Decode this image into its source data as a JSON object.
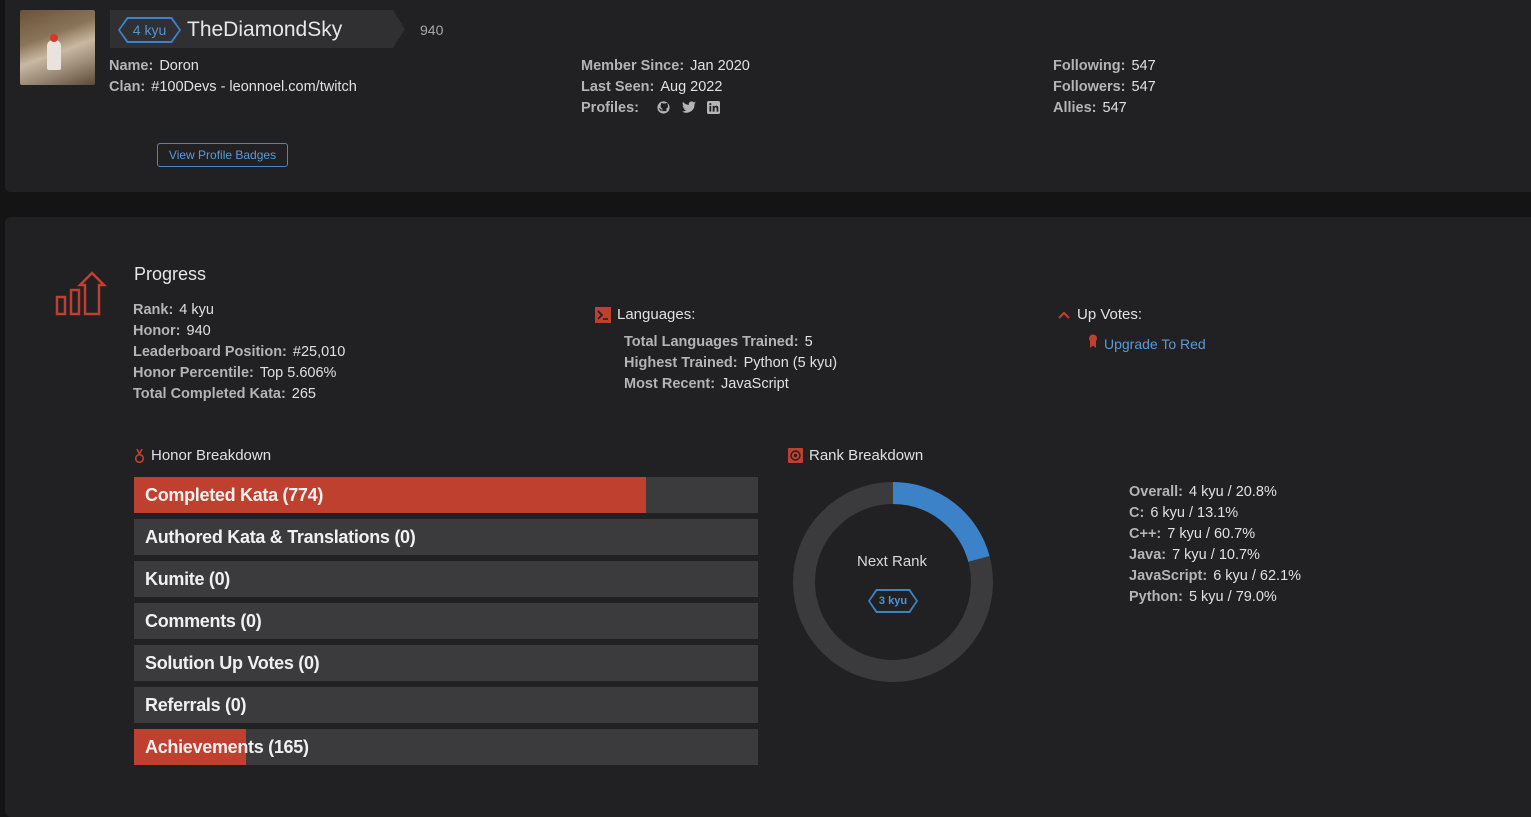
{
  "profile": {
    "kyu_badge": "4 kyu",
    "username": "TheDiamondSky",
    "honor": "940",
    "name_label": "Name:",
    "name_value": "Doron",
    "clan_label": "Clan:",
    "clan_value": "#100Devs - leonnoel.com/twitch",
    "member_since_label": "Member Since:",
    "member_since_value": "Jan 2020",
    "last_seen_label": "Last Seen:",
    "last_seen_value": "Aug 2022",
    "profiles_label": "Profiles:",
    "profile_icons": [
      "github-icon",
      "twitter-icon",
      "linkedin-icon"
    ],
    "following_label": "Following:",
    "following_value": "547",
    "followers_label": "Followers:",
    "followers_value": "547",
    "allies_label": "Allies:",
    "allies_value": "547",
    "view_badges_button": "View Profile Badges"
  },
  "progress": {
    "title": "Progress",
    "stats": [
      {
        "label": "Rank:",
        "value": "4 kyu"
      },
      {
        "label": "Honor:",
        "value": "940"
      },
      {
        "label": "Leaderboard Position:",
        "value": "#25,010"
      },
      {
        "label": "Honor Percentile:",
        "value": "Top 5.606%"
      },
      {
        "label": "Total Completed Kata:",
        "value": "265"
      }
    ],
    "languages": {
      "title": "Languages:",
      "items": [
        {
          "label": "Total Languages Trained:",
          "value": "5"
        },
        {
          "label": "Highest Trained:",
          "value": "Python (5 kyu)"
        },
        {
          "label": "Most Recent:",
          "value": "JavaScript"
        }
      ]
    },
    "upvotes": {
      "title": "Up Votes:",
      "link": "Upgrade To Red"
    }
  },
  "honor_breakdown": {
    "title": "Honor Breakdown",
    "bars": [
      {
        "label": "Completed Kata (774)",
        "fill": 0.82
      },
      {
        "label": "Authored Kata & Translations (0)",
        "fill": 0
      },
      {
        "label": "Kumite (0)",
        "fill": 0
      },
      {
        "label": "Comments (0)",
        "fill": 0
      },
      {
        "label": "Solution Up Votes (0)",
        "fill": 0
      },
      {
        "label": "Referrals (0)",
        "fill": 0
      },
      {
        "label": "Achievements (165)",
        "fill": 0.18
      }
    ]
  },
  "rank_breakdown": {
    "title": "Rank Breakdown",
    "next_rank_label": "Next Rank",
    "next_rank_badge": "3 kyu",
    "progress_fraction": 0.208,
    "items": [
      {
        "label": "Overall:",
        "value": "4 kyu / 20.8%"
      },
      {
        "label": "C:",
        "value": "6 kyu / 13.1%"
      },
      {
        "label": "C++:",
        "value": "7 kyu / 60.7%"
      },
      {
        "label": "Java:",
        "value": "7 kyu / 10.7%"
      },
      {
        "label": "JavaScript:",
        "value": "6 kyu / 62.1%"
      },
      {
        "label": "Python:",
        "value": "5 kyu / 79.0%"
      }
    ]
  },
  "colors": {
    "accent_red": "#c0402f",
    "accent_blue": "#3b82c8",
    "bar_bg": "#3b3b3e",
    "panel_bg": "#212124"
  }
}
